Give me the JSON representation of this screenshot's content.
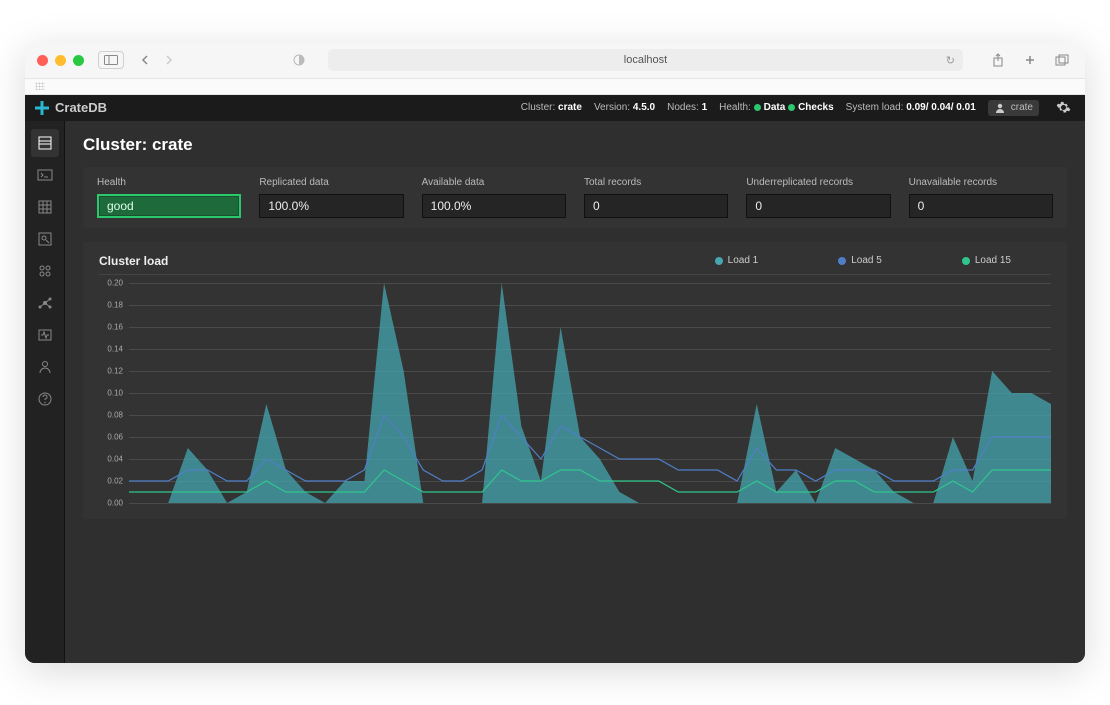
{
  "browser": {
    "url": "localhost"
  },
  "brand": "CrateDB",
  "topbar": {
    "cluster_label": "Cluster:",
    "cluster_value": "crate",
    "version_label": "Version:",
    "version_value": "4.5.0",
    "nodes_label": "Nodes:",
    "nodes_value": "1",
    "health_label": "Health:",
    "health_data": "Data",
    "health_checks": "Checks",
    "load_label": "System load:",
    "load_value": "0.09/ 0.04/ 0.01",
    "user": "crate"
  },
  "page": {
    "title": "Cluster: crate"
  },
  "metrics": {
    "health": {
      "label": "Health",
      "value": "good"
    },
    "replicated": {
      "label": "Replicated data",
      "value": "100.0%"
    },
    "available": {
      "label": "Available data",
      "value": "100.0%"
    },
    "total": {
      "label": "Total records",
      "value": "0"
    },
    "underrep": {
      "label": "Underreplicated records",
      "value": "0"
    },
    "unavail": {
      "label": "Unavailable records",
      "value": "0"
    }
  },
  "chart": {
    "title": "Cluster load",
    "legend": {
      "l1": "Load 1",
      "l5": "Load 5",
      "l15": "Load 15"
    },
    "colors": {
      "l1": "#46a6b0",
      "l5": "#4f7ec8",
      "l15": "#2fc68d"
    }
  },
  "chart_data": {
    "type": "area",
    "title": "Cluster load",
    "ylabel": "",
    "xlabel": "",
    "ylim": [
      0,
      0.2
    ],
    "y_ticks": [
      0.0,
      0.02,
      0.04,
      0.06,
      0.08,
      0.1,
      0.12,
      0.14,
      0.16,
      0.18,
      0.2
    ],
    "x": [
      0,
      1,
      2,
      3,
      4,
      5,
      6,
      7,
      8,
      9,
      10,
      11,
      12,
      13,
      14,
      15,
      16,
      17,
      18,
      19,
      20,
      21,
      22,
      23,
      24,
      25,
      26,
      27,
      28,
      29,
      30,
      31,
      32,
      33,
      34,
      35,
      36,
      37,
      38,
      39,
      40,
      41,
      42,
      43,
      44,
      45,
      46,
      47
    ],
    "series": [
      {
        "name": "Load 1",
        "values": [
          0.0,
          0.0,
          0.0,
          0.05,
          0.03,
          0.0,
          0.01,
          0.09,
          0.03,
          0.01,
          0.0,
          0.02,
          0.02,
          0.2,
          0.12,
          0.0,
          0.0,
          0.0,
          0.0,
          0.2,
          0.07,
          0.02,
          0.16,
          0.06,
          0.04,
          0.01,
          0.0,
          0.0,
          0.0,
          0.0,
          0.0,
          0.0,
          0.09,
          0.01,
          0.03,
          0.0,
          0.05,
          0.04,
          0.03,
          0.01,
          0.0,
          0.0,
          0.06,
          0.02,
          0.12,
          0.1,
          0.1,
          0.09
        ]
      },
      {
        "name": "Load 5",
        "values": [
          0.02,
          0.02,
          0.02,
          0.03,
          0.03,
          0.02,
          0.02,
          0.04,
          0.03,
          0.02,
          0.02,
          0.02,
          0.03,
          0.08,
          0.06,
          0.03,
          0.02,
          0.02,
          0.03,
          0.08,
          0.06,
          0.04,
          0.07,
          0.06,
          0.05,
          0.04,
          0.04,
          0.04,
          0.03,
          0.03,
          0.03,
          0.02,
          0.05,
          0.03,
          0.03,
          0.02,
          0.03,
          0.03,
          0.03,
          0.02,
          0.02,
          0.02,
          0.03,
          0.03,
          0.06,
          0.06,
          0.06,
          0.06
        ]
      },
      {
        "name": "Load 15",
        "values": [
          0.01,
          0.01,
          0.01,
          0.01,
          0.01,
          0.01,
          0.01,
          0.02,
          0.01,
          0.01,
          0.01,
          0.01,
          0.01,
          0.03,
          0.02,
          0.01,
          0.01,
          0.01,
          0.01,
          0.03,
          0.02,
          0.02,
          0.03,
          0.03,
          0.02,
          0.02,
          0.02,
          0.02,
          0.01,
          0.01,
          0.01,
          0.01,
          0.02,
          0.01,
          0.01,
          0.01,
          0.02,
          0.02,
          0.01,
          0.01,
          0.01,
          0.01,
          0.02,
          0.01,
          0.03,
          0.03,
          0.03,
          0.03
        ]
      }
    ]
  }
}
